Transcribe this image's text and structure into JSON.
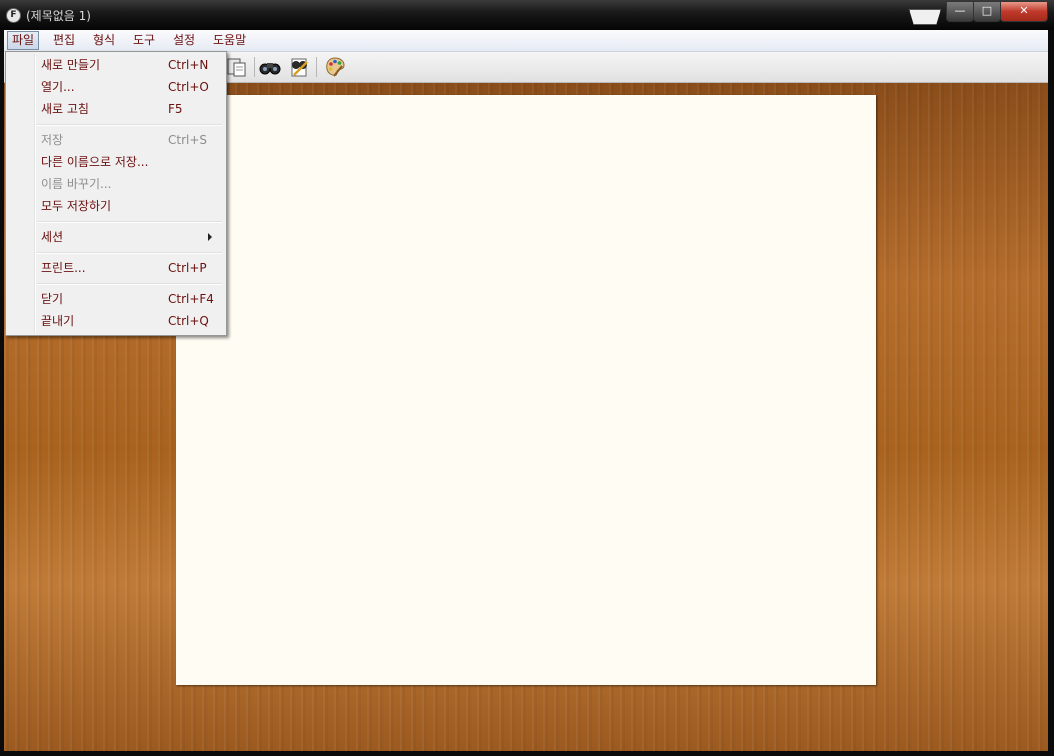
{
  "window": {
    "title": "(제목없음 1)",
    "app_icon_letter": "F",
    "controls": {
      "minimize": "—",
      "maximize": "□",
      "close": "✕"
    }
  },
  "menubar": {
    "items": [
      {
        "label": "파일",
        "active": true
      },
      {
        "label": "편집"
      },
      {
        "label": "형식"
      },
      {
        "label": "도구"
      },
      {
        "label": "설정"
      },
      {
        "label": "도움말"
      }
    ]
  },
  "toolbar": {
    "icons": [
      "paste-icon",
      "find-icon",
      "find-replace-icon",
      "color-palette-icon"
    ]
  },
  "file_menu": {
    "items": [
      {
        "label": "새로 만들기",
        "shortcut": "Ctrl+N",
        "enabled": true
      },
      {
        "label": "열기...",
        "shortcut": "Ctrl+O",
        "enabled": true
      },
      {
        "label": "새로 고침",
        "shortcut": "F5",
        "enabled": true
      },
      {
        "label": "저장",
        "shortcut": "Ctrl+S",
        "enabled": false
      },
      {
        "label": "다른 이름으로 저장...",
        "shortcut": "",
        "enabled": true
      },
      {
        "label": "이름 바꾸기...",
        "shortcut": "",
        "enabled": false
      },
      {
        "label": "모두 저장하기",
        "shortcut": "",
        "enabled": true
      },
      {
        "label": "세션",
        "shortcut": "",
        "enabled": true,
        "submenu": true
      },
      {
        "label": "프린트...",
        "shortcut": "Ctrl+P",
        "enabled": true
      },
      {
        "label": "닫기",
        "shortcut": "Ctrl+F4",
        "enabled": true
      },
      {
        "label": "끝내기",
        "shortcut": "Ctrl+Q",
        "enabled": true
      }
    ]
  },
  "colors": {
    "menu_text": "#6a1010",
    "disabled_text": "#8d8d8d",
    "paper": "#fffcf4"
  }
}
